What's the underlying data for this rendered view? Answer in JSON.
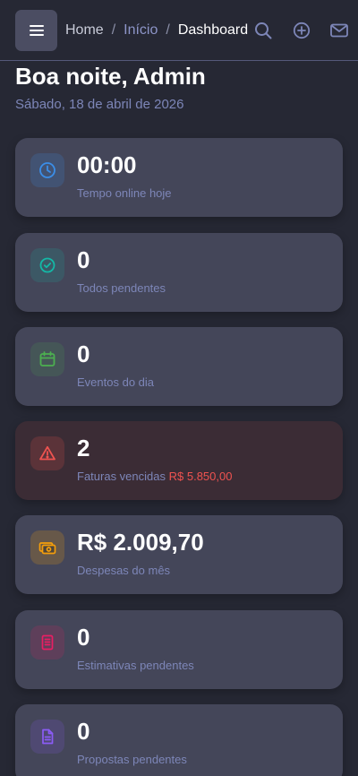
{
  "breadcrumb": {
    "home": "Home",
    "separator": "/",
    "inicio": "Início",
    "current": "Dashboard"
  },
  "header": {
    "greeting": "Boa noite, Admin",
    "date": "Sábado, 18 de abril de 2026"
  },
  "cards": [
    {
      "value": "00:00",
      "label": "Tempo online hoje",
      "icon": "clock-icon",
      "color": "#3b8ee8"
    },
    {
      "value": "0",
      "label": "Todos pendentes",
      "icon": "check-circle-icon",
      "color": "#14b8a6"
    },
    {
      "value": "0",
      "label": "Eventos do dia",
      "icon": "calendar-icon",
      "color": "#4caf50"
    },
    {
      "value": "2",
      "label": "Faturas vencidas",
      "amount": "R$ 5.850,00",
      "icon": "warning-icon",
      "color": "#ef5350"
    },
    {
      "value": "R$ 2.009,70",
      "label": "Despesas do mês",
      "icon": "money-icon",
      "color": "#f59e0b"
    },
    {
      "value": "0",
      "label": "Estimativas pendentes",
      "icon": "document-icon",
      "color": "#e91e63"
    },
    {
      "value": "0",
      "label": "Propostas pendentes",
      "icon": "file-icon",
      "color": "#8b5cf6"
    }
  ],
  "colors": {
    "background": "#262834",
    "card": "#444659",
    "card_danger": "#3b2c35",
    "label": "#7d86b8"
  }
}
